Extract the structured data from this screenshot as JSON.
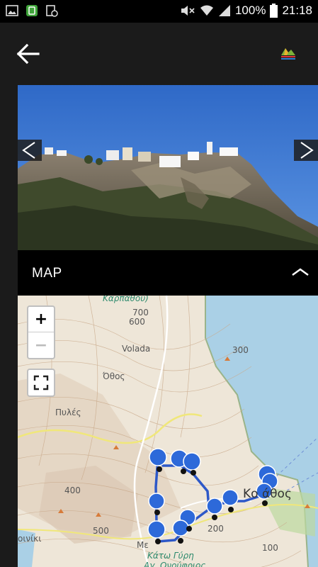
{
  "status_bar": {
    "battery": "100%",
    "time": "21:18"
  },
  "app_bar": {
    "back_icon": "arrow-left-icon",
    "logo_icon": "app-logo-icon"
  },
  "gallery": {
    "prev_icon": "chevron-left-icon",
    "next_icon": "chevron-right-icon"
  },
  "map_section": {
    "title": "MAP",
    "collapse_icon": "chevron-up-icon",
    "zoom_in": "+",
    "zoom_out": "−",
    "labels": {
      "top_road": "Καρπάθου)",
      "c700": "700",
      "c600": "600",
      "c300": "300",
      "volada": "Volada",
      "othos": "Όθος",
      "pyles": "Πυλές",
      "c400": "400",
      "c500": "500",
      "kostathos": "Κο   άθος",
      "c200": "200",
      "c100": "100",
      "orini": "οινίκι",
      "menetes": "Με",
      "kato_gyri": "Κάτω Γύρη",
      "ag_onufrios": "Αγ. Ονούφριος"
    }
  }
}
